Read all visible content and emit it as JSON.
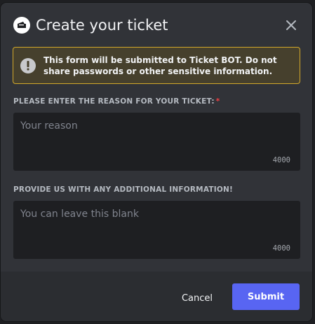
{
  "modal": {
    "title": "Create your ticket",
    "title_icon": "ticket-icon",
    "close_icon": "close-icon"
  },
  "warning": {
    "icon": "exclamation-icon",
    "text": "This form will be submitted to Ticket BOT. Do not share passwords or other sensitive information."
  },
  "fields": [
    {
      "label": "PLEASE ENTER THE REASON FOR YOUR TICKET:",
      "required_marker": "*",
      "placeholder": "Your reason",
      "value": "",
      "counter": "4000"
    },
    {
      "label": "PROVIDE US WITH ANY ADDITIONAL INFORMATION!",
      "placeholder": "You can leave this blank",
      "value": "",
      "counter": "4000"
    }
  ],
  "footer": {
    "cancel_label": "Cancel",
    "submit_label": "Submit"
  },
  "colors": {
    "accent": "#5865f2",
    "warning_border": "#d3a92b",
    "required": "#f23f43"
  }
}
